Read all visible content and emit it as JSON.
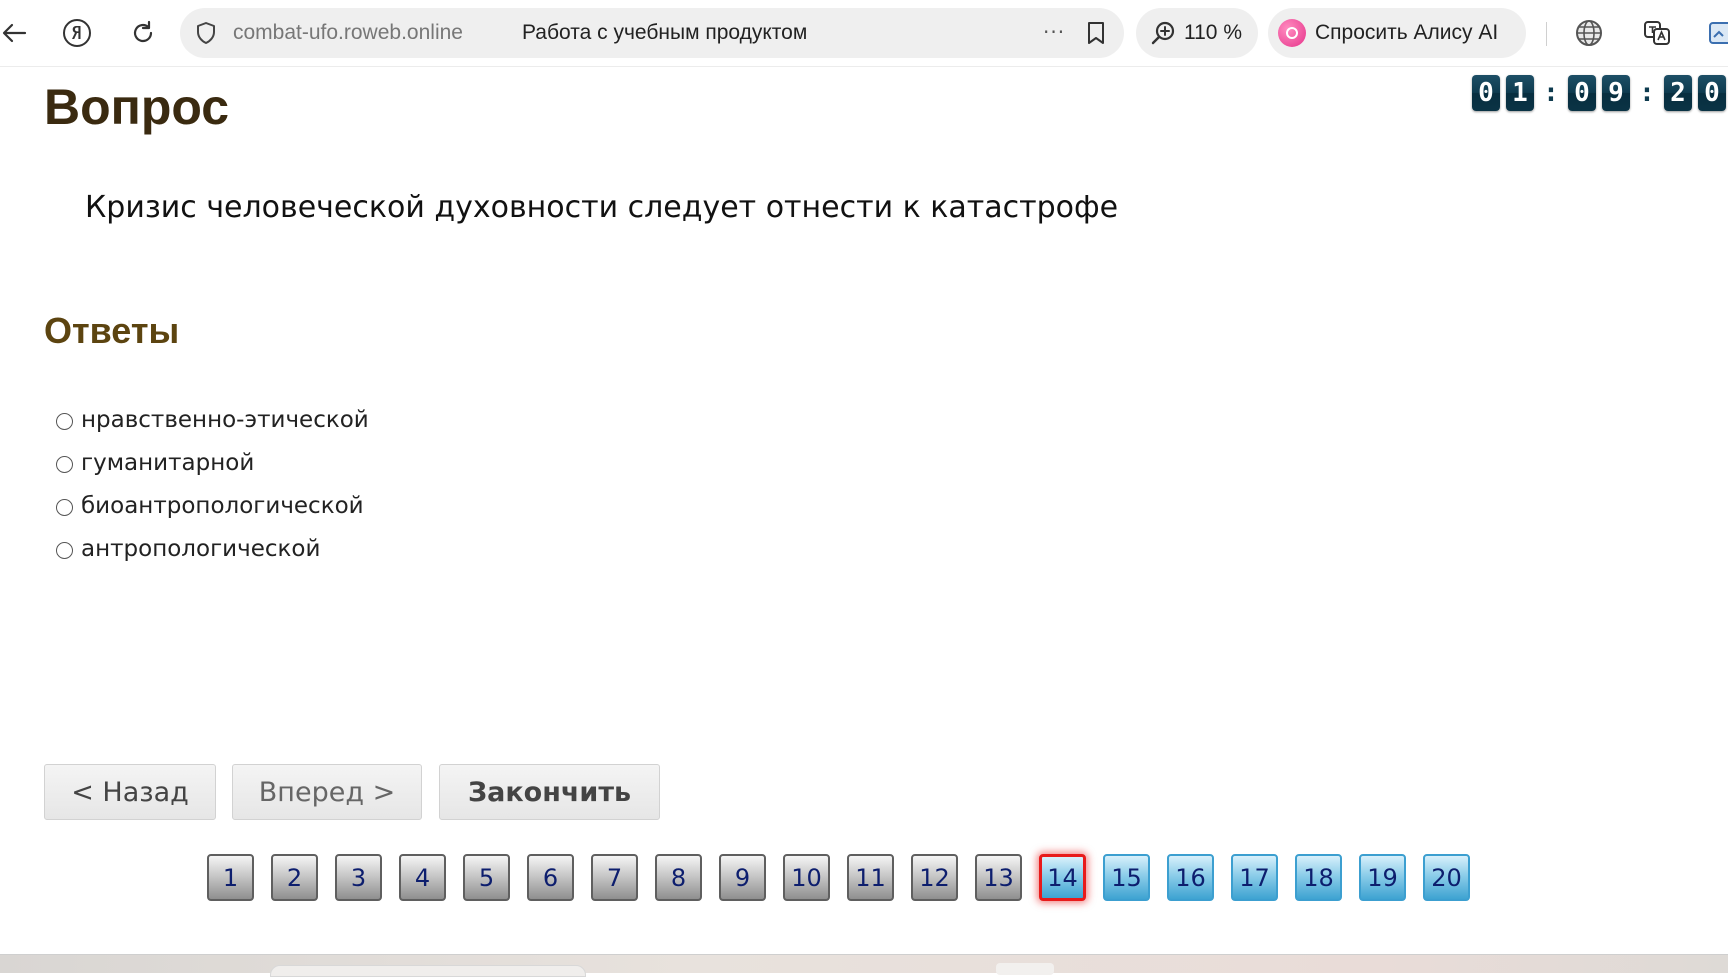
{
  "browser": {
    "domain": "combat-ufo.roweb.online",
    "page_title": "Работа с учебным продуктом",
    "more_label": "···",
    "zoom": "110 %",
    "alice_label": "Спросить Алису AI"
  },
  "quiz": {
    "heading": "Вопрос",
    "timer": {
      "digits": [
        "0",
        "1",
        "0",
        "9",
        "2",
        "0"
      ],
      "separator": ":"
    },
    "question": "Кризис человеческой духовности следует отнести к катастрофе",
    "answers_heading": "Ответы",
    "answers": [
      "нравственно-этической",
      "гуманитарной",
      "биоантропологической",
      "антропологической"
    ],
    "buttons": {
      "back": "< Назад",
      "forward": "Вперед >",
      "finish": "Закончить"
    },
    "pager": {
      "labels": [
        "1",
        "2",
        "3",
        "4",
        "5",
        "6",
        "7",
        "8",
        "9",
        "10",
        "11",
        "12",
        "13",
        "14",
        "15",
        "16",
        "17",
        "18",
        "19",
        "20"
      ],
      "current": 14,
      "answered_up_to": 13
    }
  },
  "colors": {
    "timer_digit": "#0e3b4f",
    "answered": "#9a9a9a",
    "unanswered": "#6cc2e8",
    "current_border": "#e81a1a"
  }
}
